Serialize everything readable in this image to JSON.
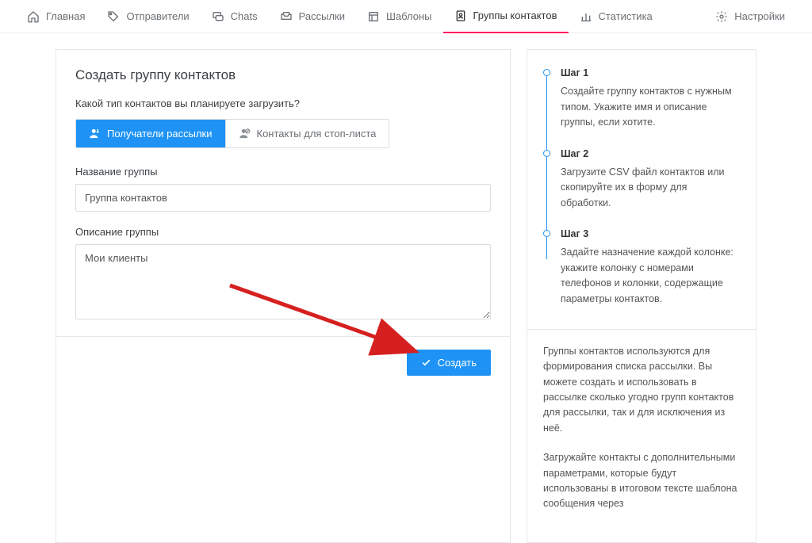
{
  "nav": {
    "items": [
      {
        "label": "Главная"
      },
      {
        "label": "Отправители"
      },
      {
        "label": "Chats"
      },
      {
        "label": "Рассылки"
      },
      {
        "label": "Шаблоны"
      },
      {
        "label": "Группы контактов"
      },
      {
        "label": "Статистика"
      }
    ],
    "settings_label": "Настройки"
  },
  "main": {
    "title": "Создать группу контактов",
    "question": "Какой тип контактов вы планируете загрузить?",
    "tab_recipients": "Получатели рассылки",
    "tab_stoplist": "Контакты для стоп-листа",
    "name_label": "Название группы",
    "name_value": "Группа контактов",
    "desc_label": "Описание группы",
    "desc_value": "Мои клиенты",
    "create_btn": "Создать"
  },
  "side": {
    "steps": [
      {
        "title": "Шаг 1",
        "text": "Создайте группу контактов с нужным типом. Укажите имя и описание группы, если хотите."
      },
      {
        "title": "Шаг 2",
        "text": "Загрузите CSV файл контактов или скопируйте их в форму для обработки."
      },
      {
        "title": "Шаг 3",
        "text": "Задайте назначение каждой колонке: укажите колонку с номерами телефонов и колонки, содержащие параметры контактов."
      }
    ],
    "para1": "Группы контактов используются для формирования списка рассылки. Вы можете создать и использовать в рассылке сколько угодно групп контактов для рассылки, так и для исключения из неё.",
    "para2": "Загружайте контакты с дополнительными параметрами, которые будут использованы в итоговом тексте шаблона сообщения через"
  }
}
